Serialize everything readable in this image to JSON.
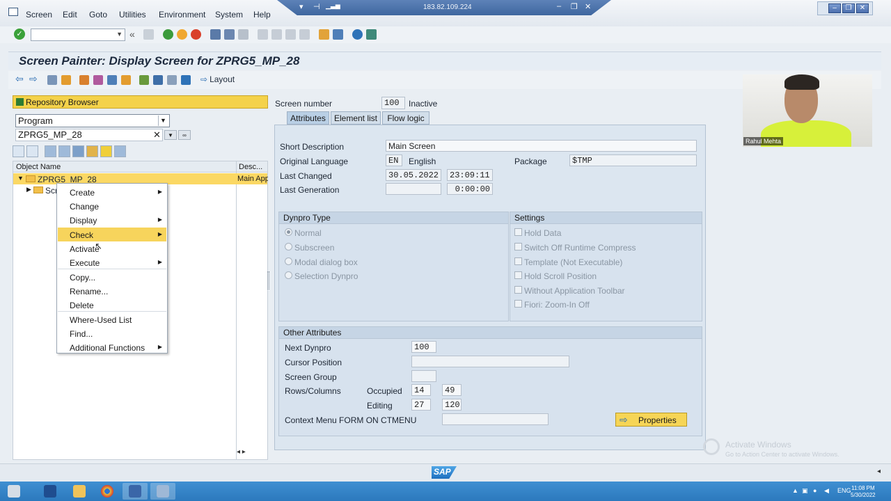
{
  "menu": [
    "Screen",
    "Edit",
    "Goto",
    "Utilities",
    "Environment",
    "System",
    "Help"
  ],
  "connection": {
    "ip": "183.82.109.224"
  },
  "title": "Screen Painter: Display Screen for ZPRG5_MP_28",
  "app_toolbar": {
    "layout_label": "Layout"
  },
  "repository": {
    "header": "Repository Browser",
    "object_type": "Program",
    "object_name": "ZPRG5_MP_28",
    "col_object": "Object Name",
    "col_desc": "Desc...",
    "tree": [
      {
        "label": "ZPRG5_MP_28",
        "desc": "Main App"
      },
      {
        "label": "Scre",
        "desc": ""
      }
    ]
  },
  "context_menu": {
    "items": [
      {
        "label": "Create",
        "sub": true
      },
      {
        "label": "Change",
        "sub": false
      },
      {
        "label": "Display",
        "sub": true
      },
      {
        "label": "Check",
        "sub": true,
        "highlight": true
      },
      {
        "label": "Activate",
        "sub": false
      },
      {
        "label": "Execute",
        "sub": true
      },
      {
        "label": "Copy...",
        "sub": false
      },
      {
        "label": "Rename...",
        "sub": false
      },
      {
        "label": "Delete",
        "sub": false
      },
      {
        "label": "Where-Used List",
        "sub": false
      },
      {
        "label": "Find...",
        "sub": false
      },
      {
        "label": "Additional Functions",
        "sub": true
      }
    ]
  },
  "screen": {
    "number_label": "Screen number",
    "number": "100",
    "status": "Inactive"
  },
  "tabs": [
    "Attributes",
    "Element list",
    "Flow logic"
  ],
  "attributes": {
    "short_desc_label": "Short Description",
    "short_desc": "Main Screen",
    "orig_lang_label": "Original Language",
    "orig_lang_code": "EN",
    "orig_lang_name": "English",
    "package_label": "Package",
    "package": "$TMP",
    "last_changed_label": "Last Changed",
    "last_changed_date": "30.05.2022",
    "last_changed_time": "23:09:11",
    "last_gen_label": "Last Generation",
    "last_gen_date": "",
    "last_gen_time": "0:00:00"
  },
  "dynpro_type": {
    "title": "Dynpro Type",
    "options": [
      "Normal",
      "Subscreen",
      "Modal dialog box",
      "Selection Dynpro"
    ],
    "selected": "Normal"
  },
  "settings": {
    "title": "Settings",
    "options": [
      "Hold Data",
      "Switch Off Runtime Compress",
      "Template (Not Executable)",
      "Hold Scroll Position",
      "Without Application Toolbar",
      "Fiori: Zoom-In Off"
    ]
  },
  "other_attributes": {
    "title": "Other Attributes",
    "next_dynpro_label": "Next Dynpro",
    "next_dynpro": "100",
    "cursor_pos_label": "Cursor Position",
    "cursor_pos": "",
    "screen_group_label": "Screen Group",
    "screen_group": "",
    "rows_cols_label": "Rows/Columns",
    "occupied_label": "Occupied",
    "occupied_rows": "14",
    "occupied_cols": "49",
    "editing_label": "Editing",
    "editing_rows": "27",
    "editing_cols": "120",
    "context_menu_label": "Context Menu FORM ON CTMENU",
    "context_menu_value": "",
    "properties_label": "Properties"
  },
  "webcam": {
    "name": "Rahul Mehta"
  },
  "watermark": {
    "title": "Activate Windows",
    "subtitle": "Go to Action Center to activate Windows."
  },
  "status": {
    "sap_logo": "SAP"
  },
  "taskbar": {
    "lang": "ENG",
    "time": "11:08 PM",
    "date": "5/30/2022"
  },
  "colors": {
    "highlight": "#f7d45c",
    "panel": "#dce6f0",
    "taskbar": "#2c79bd"
  }
}
